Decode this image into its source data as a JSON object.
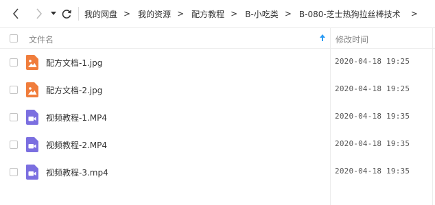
{
  "colors": {
    "image_icon": "#f07d3c",
    "video_icon": "#7b6fe0",
    "sort_arrow": "#2b9bf4"
  },
  "nav": {
    "back_icon": "chevron-left-icon",
    "forward_icon": "chevron-right-icon",
    "dropdown_icon": "caret-down-icon",
    "refresh_icon": "refresh-icon"
  },
  "breadcrumb": {
    "items": [
      "我的网盘",
      "我的资源",
      "配方教程",
      "B-小吃类",
      "B-080-芝士热狗拉丝棒技术"
    ],
    "separator": ">"
  },
  "table": {
    "header": {
      "name": "文件名",
      "time": "修改时间"
    },
    "rows": [
      {
        "name": "配方文档-1.jpg",
        "time": "2020-04-18 19:25",
        "type": "image"
      },
      {
        "name": "配方文档-2.jpg",
        "time": "2020-04-18 19:25",
        "type": "image"
      },
      {
        "name": "视频教程-1.MP4",
        "time": "2020-04-18 19:35",
        "type": "video"
      },
      {
        "name": "视频教程-2.MP4",
        "time": "2020-04-18 19:35",
        "type": "video"
      },
      {
        "name": "视频教程-3.mp4",
        "time": "2020-04-18 19:35",
        "type": "video"
      }
    ]
  }
}
